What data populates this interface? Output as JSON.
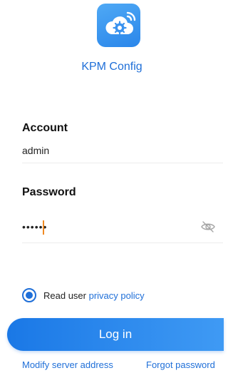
{
  "app": {
    "name": "KPM Config",
    "icon": "cloud-gear-wifi-icon",
    "accent_color": "#1f6fd8"
  },
  "form": {
    "account_label": "Account",
    "account_value": "admin",
    "password_label": "Password",
    "password_value": "••••••",
    "visibility_icon": "eye-slash-icon"
  },
  "policy": {
    "text": "Read user ",
    "link": "privacy policy",
    "checked": true
  },
  "actions": {
    "login_label": "Log in",
    "modify_server_label": "Modify server address",
    "forgot_password_label": "Forgot password"
  }
}
